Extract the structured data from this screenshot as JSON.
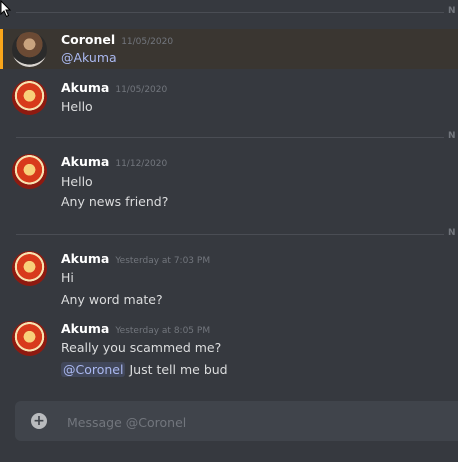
{
  "dividers": [
    {
      "date": "N"
    },
    {
      "date": "N"
    },
    {
      "date": "N"
    }
  ],
  "messages": [
    {
      "author": "Coronel",
      "timestamp": "11/05/2020",
      "lines": [
        "@Akuma"
      ]
    },
    {
      "author": "Akuma",
      "timestamp": "11/05/2020",
      "lines": [
        "Hello"
      ]
    },
    {
      "author": "Akuma",
      "timestamp": "11/12/2020",
      "lines": [
        "Hello",
        "Any news friend?"
      ]
    },
    {
      "author": "Akuma",
      "timestamp": "Yesterday at 7:03 PM",
      "lines": [
        "Hi",
        "Any word mate?"
      ]
    },
    {
      "author": "Akuma",
      "timestamp": "Yesterday at 8:05 PM",
      "lines": [
        "Really you scammed me?",
        "Just tell me bud"
      ],
      "mention": "@Coronel"
    }
  ],
  "composer": {
    "placeholder": "Message @Coronel"
  },
  "colors": {
    "background": "#36393f",
    "mention_highlight": "#faa61a",
    "mention_text": "#aab8f0"
  }
}
